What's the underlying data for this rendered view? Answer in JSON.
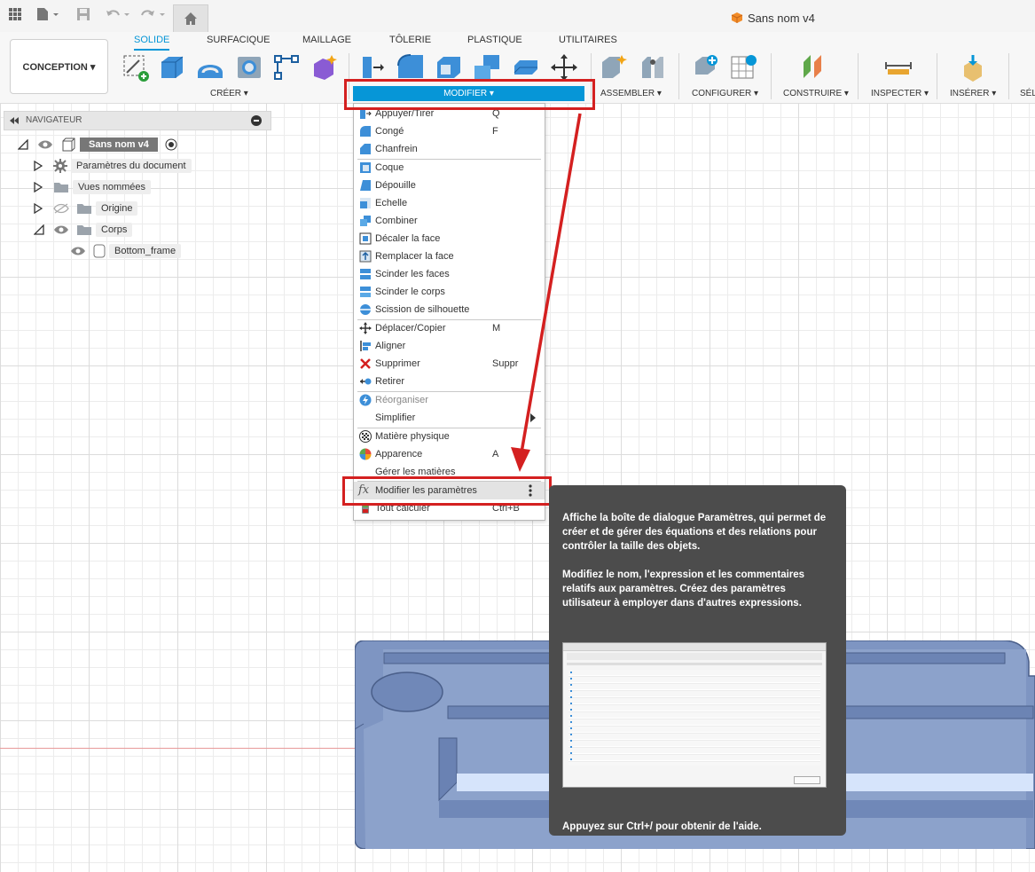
{
  "topbar": {
    "doc_title": "Sans nom v4"
  },
  "ribbon": {
    "tabs": [
      "SOLIDE",
      "SURFACIQUE",
      "MAILLAGE",
      "TÔLERIE",
      "PLASTIQUE",
      "UTILITAIRES"
    ],
    "workspace": "CONCEPTION ▾",
    "groups": {
      "creer": "CRÉER ▾",
      "modifier": "MODIFIER ▾",
      "assembler": "ASSEMBLER ▾",
      "configurer": "CONFIGURER ▾",
      "construire": "CONSTRUIRE ▾",
      "inspecter": "INSPECTER ▾",
      "inserer": "INSÉRER ▾",
      "selection": "SÉL"
    }
  },
  "navigator": {
    "title": "NAVIGATEUR",
    "root": "Sans nom v4",
    "items": [
      "Paramètres du document",
      "Vues nommées",
      "Origine",
      "Corps"
    ],
    "body": "Bottom_frame"
  },
  "menu": {
    "items": [
      {
        "label": "Appuyer/Tirer",
        "shortcut": "Q",
        "icon": "press-pull-icon"
      },
      {
        "label": "Congé",
        "shortcut": "F",
        "icon": "fillet-icon"
      },
      {
        "label": "Chanfrein",
        "shortcut": "",
        "icon": "chamfer-icon"
      },
      {
        "label": "Coque",
        "shortcut": "",
        "icon": "shell-icon"
      },
      {
        "label": "Dépouille",
        "shortcut": "",
        "icon": "draft-icon"
      },
      {
        "label": "Echelle",
        "shortcut": "",
        "icon": "scale-icon"
      },
      {
        "label": "Combiner",
        "shortcut": "",
        "icon": "combine-icon"
      },
      {
        "label": "Décaler la face",
        "shortcut": "",
        "icon": "offset-face-icon"
      },
      {
        "label": "Remplacer la face",
        "shortcut": "",
        "icon": "replace-face-icon"
      },
      {
        "label": "Scinder les faces",
        "shortcut": "",
        "icon": "split-face-icon"
      },
      {
        "label": "Scinder le corps",
        "shortcut": "",
        "icon": "split-body-icon"
      },
      {
        "label": "Scission de silhouette",
        "shortcut": "",
        "icon": "silhouette-split-icon"
      },
      {
        "label": "Déplacer/Copier",
        "shortcut": "M",
        "icon": "move-icon"
      },
      {
        "label": "Aligner",
        "shortcut": "",
        "icon": "align-icon"
      },
      {
        "label": "Supprimer",
        "shortcut": "Suppr",
        "icon": "delete-icon"
      },
      {
        "label": "Retirer",
        "shortcut": "",
        "icon": "remove-icon"
      },
      {
        "label": "Réorganiser",
        "shortcut": "",
        "icon": "rearrange-icon"
      },
      {
        "label": "Simplifier",
        "shortcut": "",
        "icon": "simplify-icon"
      },
      {
        "label": "Matière physique",
        "shortcut": "",
        "icon": "physical-material-icon"
      },
      {
        "label": "Apparence",
        "shortcut": "A",
        "icon": "appearance-icon"
      },
      {
        "label": "Gérer les matières",
        "shortcut": "",
        "icon": "manage-materials-icon"
      },
      {
        "label": "Modifier les paramètres",
        "shortcut": "",
        "icon": "fx-icon"
      },
      {
        "label": "Tout calculer",
        "shortcut": "Ctrl+B",
        "icon": "compute-all-icon"
      }
    ]
  },
  "tooltip": {
    "p1": "Affiche la boîte de dialogue Paramètres, qui permet de créer et de gérer des équations et des relations pour contrôler la taille des objets.",
    "p2": "Modifiez le nom, l'expression et les commentaires relatifs aux paramètres. Créez des paramètres utilisateur à employer dans d'autres expressions.",
    "help": "Appuyez sur Ctrl+/ pour obtenir de l'aide."
  }
}
